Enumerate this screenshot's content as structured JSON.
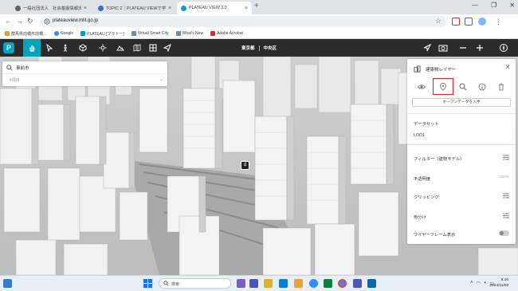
{
  "browser": {
    "tabs": [
      {
        "label": "一般社団法人　社会基盤情報流通",
        "active": false
      },
      {
        "label": "TOPIC 2｜PLATEAU VIEWで学ぶ",
        "active": false
      },
      {
        "label": "PLATEAU VIEW 3.0",
        "active": true
      }
    ],
    "new_tab": "+",
    "window_controls": [
      "—",
      "❐",
      "✕"
    ],
    "url": "plateauview.mlit.go.jp",
    "bookmarks": [
      "群馬県前橋市前橋…",
      "Google",
      "PLATEAU [プラトー]",
      "Virtual Smart City",
      "What's New",
      "Adobe Acrobat"
    ]
  },
  "app": {
    "logo": "P",
    "breadcrumb": {
      "prefecture": "東京都",
      "ward": "中央区"
    }
  },
  "search": {
    "value": "事前市",
    "sub": "4項目"
  },
  "layer_panel": {
    "title": "建築物レイヤー",
    "open_data_button": "オープンデータを入手",
    "dataset_label": "データセット",
    "lod_value": "LOD1",
    "filter_label": "フィルター（建物モデル）",
    "opacity_label": "不透明度",
    "opacity_value": "100%",
    "clipping_label": "クリッピング",
    "color_label": "色分け",
    "wireframe_label": "ワイヤーフレーム表示"
  },
  "map": {
    "marker_label": "d"
  },
  "taskbar": {
    "search_label": "検索",
    "time": "9:40",
    "date": "2024/11/08"
  },
  "colors": {
    "accent": "#00a5bd",
    "toolbar_dark": "#2b2b2b",
    "highlight": "#e02020",
    "taskbar": "#e8eef5"
  }
}
